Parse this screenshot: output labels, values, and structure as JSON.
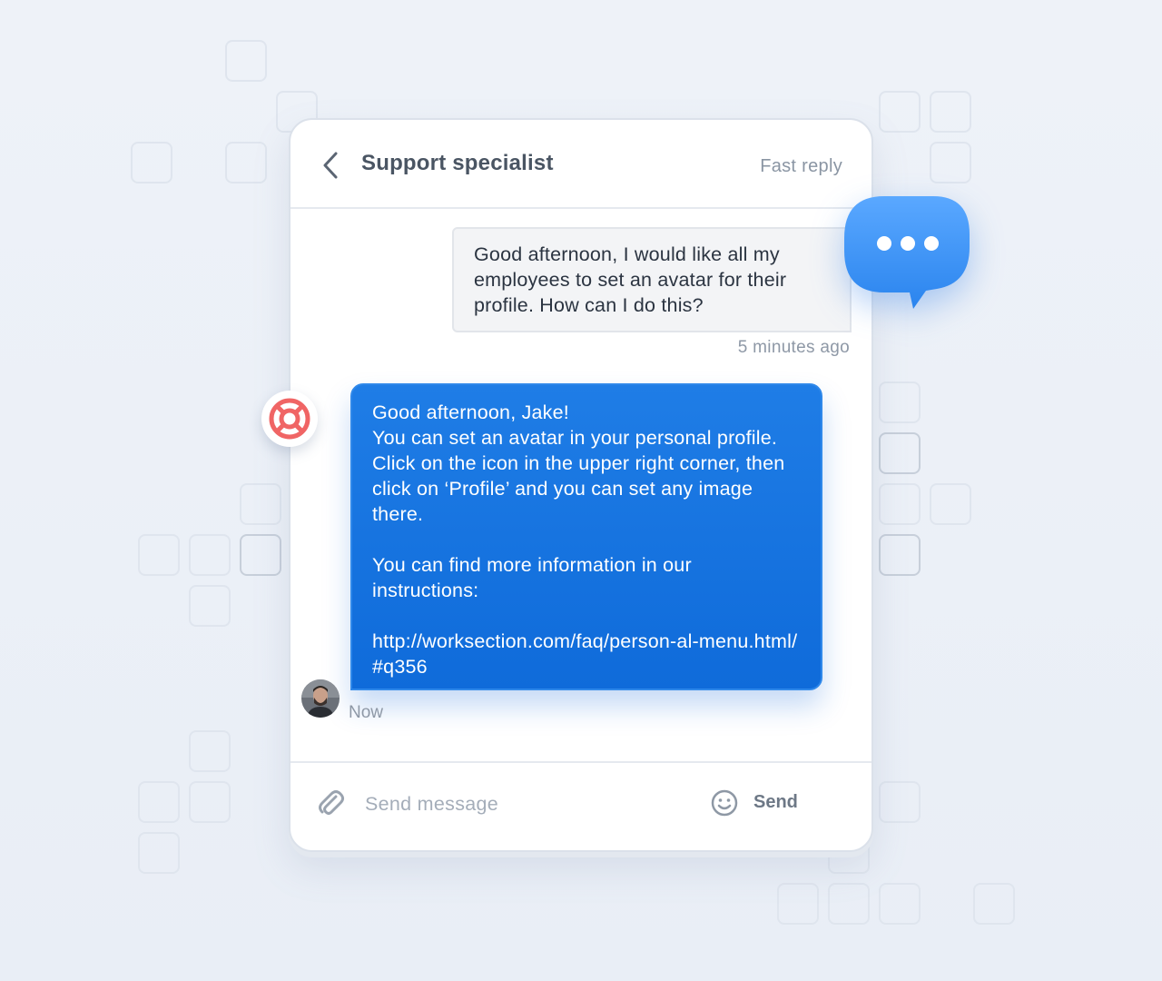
{
  "header": {
    "title": "Support specialist",
    "fast_reply_label": "Fast reply"
  },
  "messages": {
    "incoming": {
      "text": "Good afternoon, I would like all my employees to set an avatar for their profile. How can I do this?",
      "time": "5 minutes ago"
    },
    "outgoing": {
      "greeting": "Good afternoon, Jake!",
      "body": "You can set an avatar in your personal profile. Click on the icon in the upper right corner, then click on ‘Profile’ and you can set any image there.",
      "more_info": "You can find more information in our instructions:",
      "link": "http://worksection.com/faq/person-al-menu.html/#q356",
      "time": "Now"
    }
  },
  "composer": {
    "placeholder": "Send message",
    "send_label": "Send"
  },
  "icons": {
    "back": "chevron-left-icon",
    "attach": "paperclip-icon",
    "emoji": "smiley-icon",
    "support": "lifebuoy-icon",
    "typing": "typing-bubble-icon"
  },
  "colors": {
    "accent": "#1a74e0",
    "support_red": "#f06565",
    "typing_blue": "#3d93f5"
  }
}
